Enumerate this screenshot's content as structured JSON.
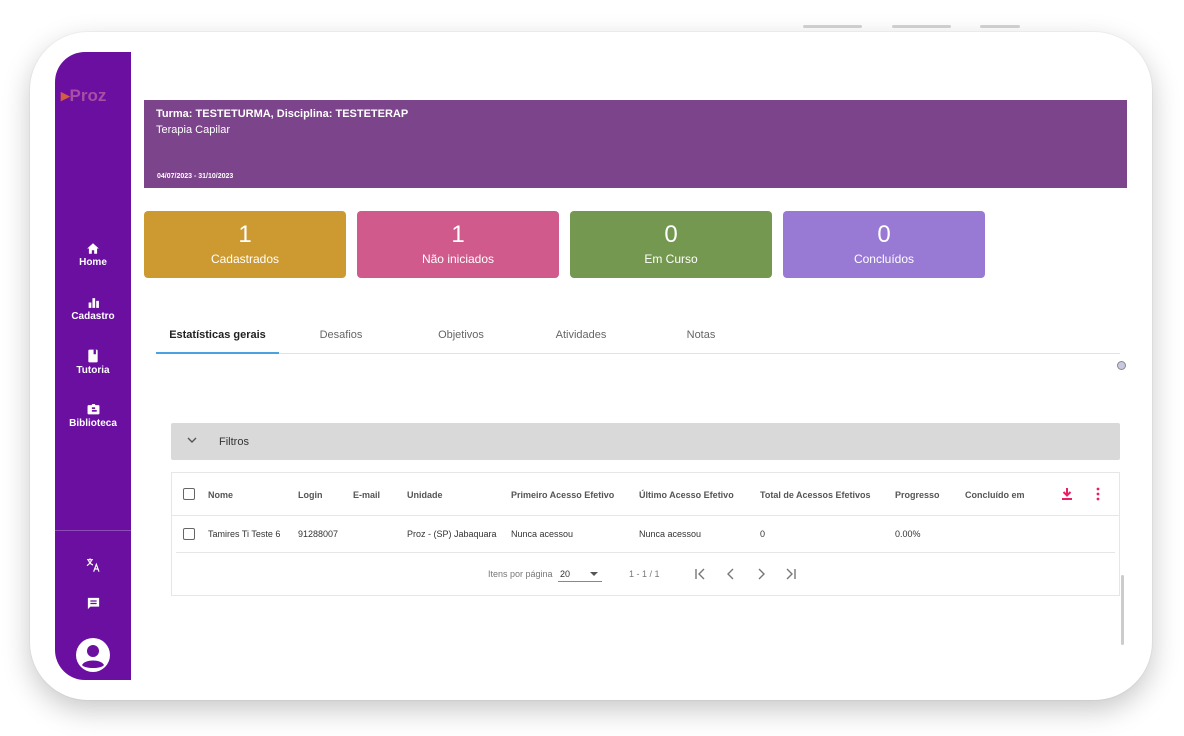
{
  "app": {
    "logo_text": "Proz"
  },
  "sidebar": {
    "items": [
      {
        "label": "Home",
        "icon": "home-icon"
      },
      {
        "label": "Cadastro",
        "icon": "bar-chart-icon"
      },
      {
        "label": "Tutoria",
        "icon": "book-icon"
      },
      {
        "label": "Biblioteca",
        "icon": "library-icon"
      }
    ],
    "bottom_icons": [
      "translate-icon",
      "chat-icon",
      "account-icon"
    ]
  },
  "banner": {
    "title": "Turma: TESTETURMA, Disciplina: TESTETERAP",
    "subtitle": "Terapia Capilar",
    "dates": "04/07/2023 - 31/10/2023",
    "color": "#7c448a"
  },
  "cards": [
    {
      "value": "1",
      "label": "Cadastrados",
      "color": "#cd9a31"
    },
    {
      "value": "1",
      "label": "Não iniciados",
      "color": "#cf5a8b"
    },
    {
      "value": "0",
      "label": "Em Curso",
      "color": "#74984f"
    },
    {
      "value": "0",
      "label": "Concluídos",
      "color": "#9879d4"
    }
  ],
  "tabs": [
    {
      "label": "Estatísticas gerais",
      "active": true
    },
    {
      "label": "Desafios",
      "active": false
    },
    {
      "label": "Objetivos",
      "active": false
    },
    {
      "label": "Atividades",
      "active": false
    },
    {
      "label": "Notas",
      "active": false
    }
  ],
  "filters": {
    "label": "Filtros"
  },
  "table": {
    "columns": [
      "Nome",
      "Login",
      "E-mail",
      "Unidade",
      "Primeiro Acesso Efetivo",
      "Último Acesso Efetivo",
      "Total de Acessos Efetivos",
      "Progresso",
      "Concluído em"
    ],
    "rows": [
      [
        "Tamires Ti Teste 6",
        "91288007",
        "",
        "Proz - (SP) Jabaquara",
        "Nunca acessou",
        "Nunca acessou",
        "0",
        "0.00%",
        ""
      ]
    ],
    "actions": [
      "download-icon",
      "more-vert-icon"
    ],
    "accent": "#e91e63"
  },
  "pagination": {
    "items_per_page_label": "Itens por página",
    "page_size": "20",
    "range": "1 - 1 / 1"
  }
}
